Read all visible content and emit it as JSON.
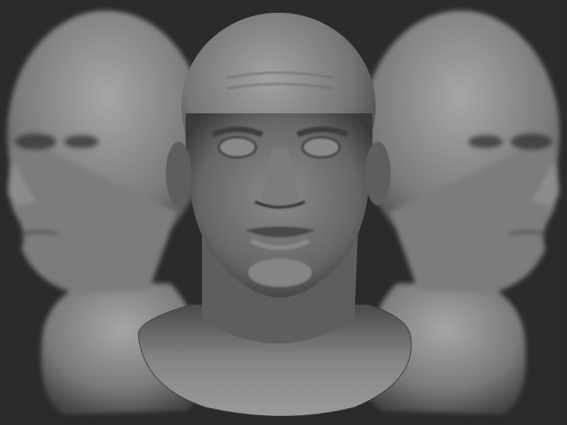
{
  "scene": {
    "subject": "three-head-sculpt-render",
    "colors": {
      "background": "#2b2b2b",
      "clay_light": "#9a9a9a",
      "clay_mid": "#6e6e6e",
      "clay_dark": "#3a3a3a"
    }
  }
}
